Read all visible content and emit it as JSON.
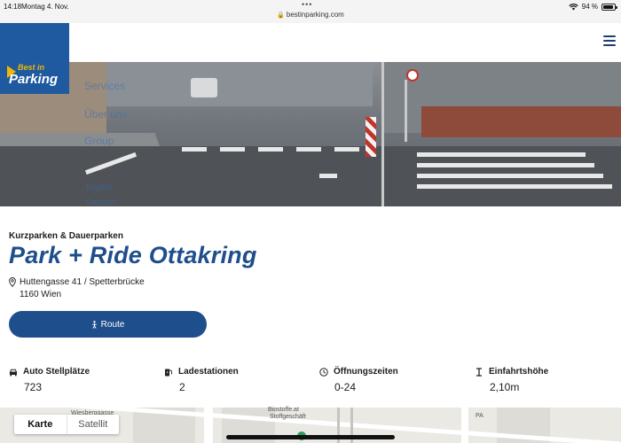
{
  "status_bar": {
    "time": "14:18",
    "date": "Montag 4. Nov.",
    "url": "bestinparking.com",
    "battery": "94 %",
    "battery_level": 0.94
  },
  "header": {
    "logo_line1": "Best in",
    "logo_line2": "Parking",
    "menu_icon": "hamburger-menu-icon"
  },
  "hero": {
    "ghost_menu": [
      "Services",
      "Über uns",
      "Group",
      "English",
      "Deutsch"
    ]
  },
  "parking": {
    "category": "Kurzparken & Dauerparken",
    "name": "Park + Ride Ottakring",
    "address_line1": "Huttengasse 41 / Spetterbrücke",
    "address_line2": "1160 Wien",
    "route_label": "Route"
  },
  "facts": [
    {
      "icon": "car-icon",
      "label": "Auto Stellplätze",
      "value": "723"
    },
    {
      "icon": "ev-charger-icon",
      "label": "Ladestationen",
      "value": "2"
    },
    {
      "icon": "clock-icon",
      "label": "Öffnungszeiten",
      "value": "0-24"
    },
    {
      "icon": "height-icon",
      "label": "Einfahrtshöhe",
      "value": "2,10m"
    }
  ],
  "map": {
    "tabs": [
      "Karte",
      "Satellit"
    ],
    "active_tab": "Karte",
    "labels": [
      "Wiesberggasse",
      "Biostoffe.at",
      "Stoffgeschäft",
      "PA"
    ]
  },
  "colors": {
    "brand_blue": "#1f4e8c",
    "logo_blue": "#1f5aa0",
    "logo_yellow": "#f2b600"
  }
}
